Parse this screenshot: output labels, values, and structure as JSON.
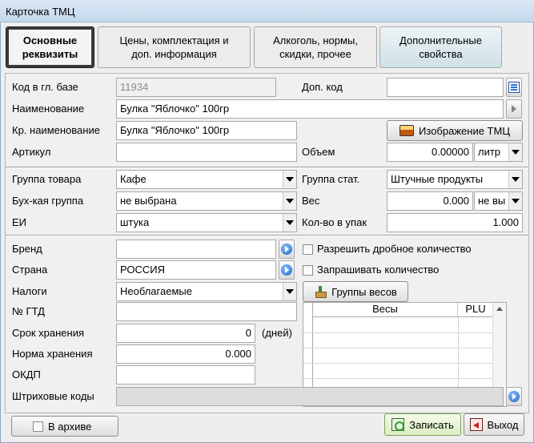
{
  "window": {
    "title": "Карточка ТМЦ"
  },
  "tabs": [
    {
      "label": "Основные\nреквизиты",
      "active": true
    },
    {
      "label": "Цены, комплектация и\nдоп.  информация",
      "active": false
    },
    {
      "label": "Алкоголь, нормы,\nскидки, прочее",
      "active": false
    },
    {
      "label": "Дополнительные\nсвойства",
      "active": false
    }
  ],
  "fields": {
    "kod_label": "Код в гл. базе",
    "kod_value": "11934",
    "dop_kod_label": "Доп. код",
    "dop_kod_value": "",
    "name_label": "Наименование",
    "name_value": "Булка \"Яблочко\" 100гр",
    "short_name_label": "Кр. наименование",
    "short_name_value": "Булка \"Яблочко\" 100гр",
    "image_button": "Изображение ТМЦ",
    "artikul_label": "Артикул",
    "artikul_value": "",
    "volume_label": "Объем",
    "volume_value": "0.00000",
    "volume_unit": "литр",
    "group_label": "Группа товара",
    "group_value": "Кафе",
    "stat_group_label": "Группа стат.",
    "stat_group_value": "Штучные продукты",
    "buh_group_label": "Бух-кая группа",
    "buh_group_value": "не выбрана",
    "weight_label": "Вес",
    "weight_value": "0.000",
    "weight_unit": "не вы",
    "ei_label": "ЕИ",
    "ei_value": "штука",
    "pack_label": "Кол-во в упак",
    "pack_value": "1.000",
    "brand_label": "Бренд",
    "brand_value": "",
    "country_label": "Страна",
    "country_value": "РОССИЯ",
    "tax_label": "Налоги",
    "tax_value": "Необлагаемые",
    "gtd_label": "№ ГТД",
    "gtd_value": "",
    "shelf_life_label": "Срок хранения",
    "shelf_life_value": "0",
    "shelf_life_unit": "(дней)",
    "storage_label": "Норма хранения",
    "storage_value": "0.000",
    "okdp_label": "ОКДП",
    "okdp_value": "",
    "barcodes_label": "Штриховые коды",
    "barcodes_value": ""
  },
  "checkboxes": {
    "fractional": {
      "label": "Разрешить дробное количество",
      "checked": false
    },
    "ask_qty": {
      "label": "Запрашивать количество",
      "checked": false
    },
    "archive": {
      "label": "В архиве",
      "checked": false
    }
  },
  "weight_groups_button": "Группы весов",
  "scales_grid": {
    "columns": [
      "Весы",
      "PLU"
    ]
  },
  "buttons": {
    "save": "Записать",
    "exit": "Выход"
  }
}
